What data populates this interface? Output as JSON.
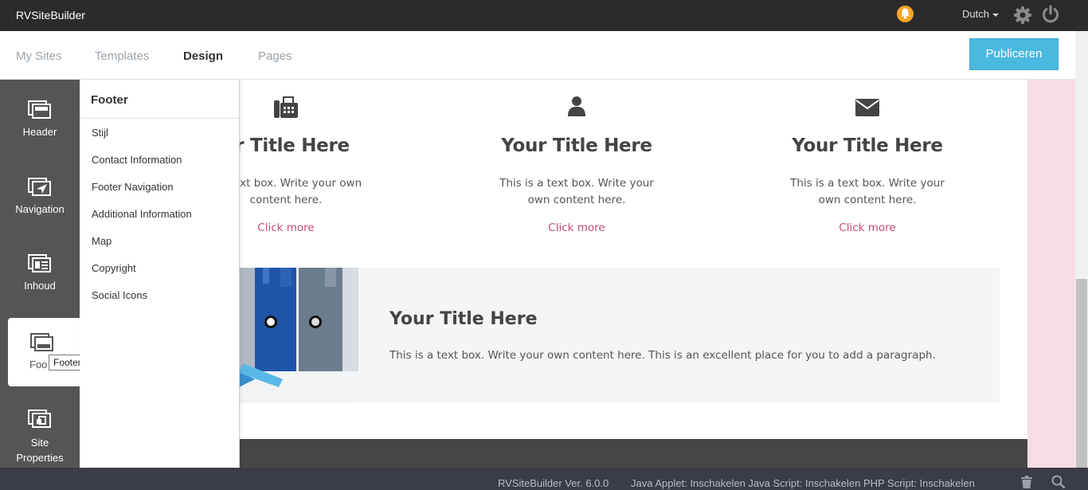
{
  "app": {
    "title": "RVSiteBuilder"
  },
  "topbar": {
    "language": "Dutch",
    "notification_icon": "bell-icon",
    "settings_icon": "gear-icon",
    "logout_icon": "power-icon"
  },
  "nav": {
    "tabs": [
      {
        "label": "My Sites"
      },
      {
        "label": "Templates"
      },
      {
        "label": "Design",
        "active": true
      },
      {
        "label": "Pages"
      }
    ],
    "publish_label": "Publiceren",
    "publish_color": "#4ab9e0"
  },
  "sidebar": {
    "items": [
      {
        "label": "Header",
        "icon": "header-icon"
      },
      {
        "label": "Navigation",
        "icon": "navigation-icon"
      },
      {
        "label": "Inhoud",
        "icon": "content-icon"
      },
      {
        "label": "Foo",
        "icon": "footer-icon",
        "active": true
      },
      {
        "label": "Site",
        "label2": "Properties",
        "icon": "site-properties-icon"
      }
    ],
    "tooltip": "Footer"
  },
  "flyout": {
    "title": "Footer",
    "items": [
      {
        "label": "Stijl"
      },
      {
        "label": "Contact Information"
      },
      {
        "label": "Footer Navigation"
      },
      {
        "label": "Additional Information"
      },
      {
        "label": "Map"
      },
      {
        "label": "Copyright"
      },
      {
        "label": "Social Icons"
      }
    ]
  },
  "canvas": {
    "features": [
      {
        "icon": "fax-icon",
        "title": "ur Title Here",
        "text": "s a text box. Write your own content here.",
        "link": "Click more"
      },
      {
        "icon": "user-icon",
        "title": "Your Title Here",
        "text": "This is a text box. Write your own content here.",
        "link": "Click more"
      },
      {
        "icon": "envelope-icon",
        "title": "Your Title Here",
        "text": "This is a text box. Write your own content here.",
        "link": "Click more"
      }
    ],
    "banner": {
      "title": "Your Title Here",
      "text": "This is a text box. Write your own content here. This is an excellent place for you to add a paragraph."
    },
    "accent_color": "#c2497a"
  },
  "status": {
    "version": "RVSiteBuilder Ver. 6.0.0",
    "scripts": "Java Applet: Inschakelen Java Script: Inschakelen PHP Script: Inschakelen"
  }
}
